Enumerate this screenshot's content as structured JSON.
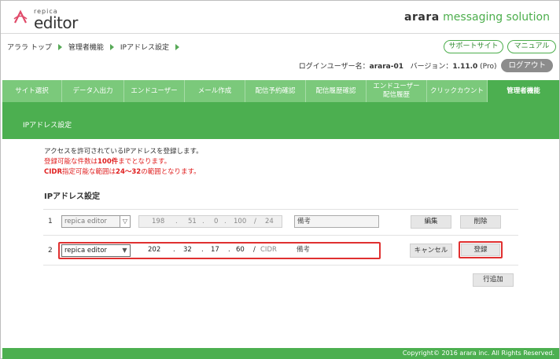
{
  "header": {
    "logo_small": "repica",
    "logo_big": "editor",
    "brand_bold": "arara",
    "brand_rest": "messaging solution"
  },
  "breadcrumb": [
    "アララ トップ",
    "管理者機能",
    "IPアドレス設定"
  ],
  "top_buttons": {
    "support": "サポートサイト",
    "manual": "マニュアル"
  },
  "login": {
    "label": "ログインユーザー名：",
    "user": "arara-01",
    "version_label": "バージョン：",
    "version": "1.11.0",
    "edition": "(Pro)",
    "logout": "ログアウト"
  },
  "tabs": [
    {
      "label": "サイト選択",
      "active": false
    },
    {
      "label": "データ入出力",
      "active": false
    },
    {
      "label": "エンドユーザー",
      "active": false
    },
    {
      "label": "メール作成",
      "active": false
    },
    {
      "label": "配信予約確認",
      "active": false
    },
    {
      "label": "配信履歴確認",
      "active": false
    },
    {
      "label": "エンドユーザー\n配信履歴",
      "active": false
    },
    {
      "label": "クリックカウント",
      "active": false
    },
    {
      "label": "管理者機能",
      "active": true
    }
  ],
  "page_title": "IPアドレス設定",
  "description": {
    "line1": "アクセスを許可されているIPアドレスを登録します。",
    "line2_pre": "登録可能な件数は",
    "line2_bold": "100件",
    "line2_post": "までとなります。",
    "line3_bold1": "CIDR",
    "line3_mid": "指定可能な範囲は",
    "line3_bold2": "24～32",
    "line3_post": "の範囲となります。"
  },
  "section_title": "IPアドレス設定",
  "rows": [
    {
      "num": "1",
      "site": "repica editor",
      "ip": [
        "198",
        "51",
        "0",
        "100"
      ],
      "cidr": "24",
      "note": "備考",
      "btn1": "編集",
      "btn2": "削除"
    },
    {
      "num": "2",
      "site": "repica editor",
      "ip": [
        "202",
        "32",
        "17",
        "60"
      ],
      "cidr": "CIDR",
      "note": "備考",
      "btn1": "キャンセル",
      "btn2": "登録"
    }
  ],
  "add_row": "行追加",
  "footer": "Copyright© 2016 arara inc. All Rights Reserved.",
  "colors": {
    "accent": "#4caf50",
    "tab_bg": "#7bc97b",
    "highlight": "#e03030"
  }
}
